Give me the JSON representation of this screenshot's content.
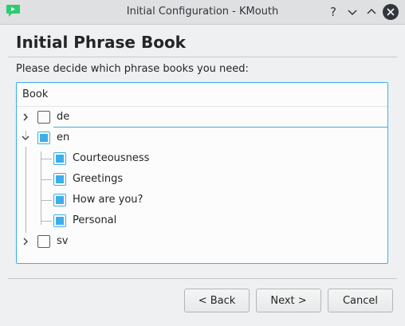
{
  "window": {
    "title": "Initial Configuration - KMouth",
    "help_glyph": "?",
    "minimize_glyph": "",
    "maximize_glyph": "",
    "close_glyph": ""
  },
  "page": {
    "heading": "Initial Phrase Book",
    "subtitle": "Please decide which phrase books you need:"
  },
  "tree": {
    "column_header": "Book",
    "items": [
      {
        "label": "de",
        "checked": false,
        "expanded": false
      },
      {
        "label": "en",
        "checked": true,
        "expanded": true,
        "children": [
          {
            "label": "Courteousness",
            "checked": true
          },
          {
            "label": "Greetings",
            "checked": true
          },
          {
            "label": "How are you?",
            "checked": true
          },
          {
            "label": "Personal",
            "checked": true
          }
        ]
      },
      {
        "label": "sv",
        "checked": false,
        "expanded": false
      }
    ]
  },
  "buttons": {
    "back": "< Back",
    "next": "Next >",
    "cancel": "Cancel"
  },
  "colors": {
    "accent": "#3daee9",
    "titlebar": "#dee0e2",
    "background": "#eff0f1"
  },
  "icons": {
    "app": "kmouth-app-icon",
    "help": "question-icon",
    "minimize": "chevron-down-icon",
    "maximize": "chevron-up-icon",
    "close": "close-icon"
  }
}
